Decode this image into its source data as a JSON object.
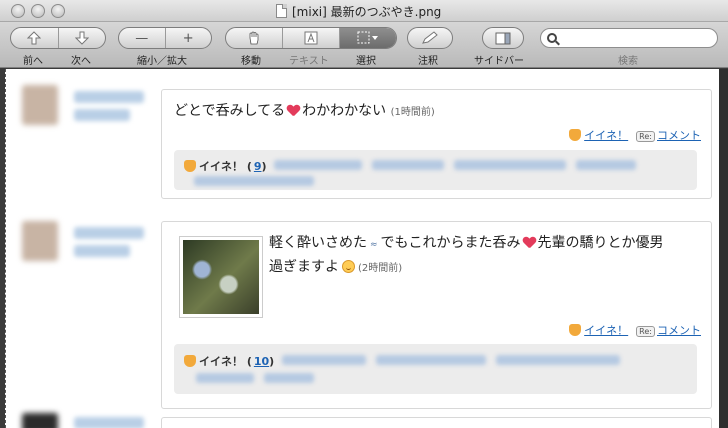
{
  "window": {
    "title": "[mixi] 最新のつぶやき.png"
  },
  "toolbar": {
    "back_label": "前へ",
    "forward_label": "次へ",
    "zoom_label": "縮小／拡大",
    "zoom_out_glyph": "—",
    "zoom_in_glyph": "+",
    "move_label": "移動",
    "text_label": "テキスト",
    "select_label": "選択",
    "annotate_label": "注釈",
    "sidebar_label": "サイドバー",
    "search_label": "検索",
    "search_placeholder": ""
  },
  "posts": [
    {
      "text_before": "どとで呑みしてる",
      "text_after": "わかわかない",
      "time": "(1時間前)",
      "iine_label": "イイネ！",
      "comment_label": "コメント",
      "re_badge": "Re:",
      "iine_count_prefix": "イイネ！ (",
      "iine_count": "9",
      "iine_count_suffix": ")"
    },
    {
      "text_line1_a": "軽く酔いさめた",
      "text_line1_b": "でもこれからまた呑み",
      "text_line1_c": "先輩の驕りとか優男",
      "text_line2": "過ぎますよ",
      "time": "(2時間前)",
      "iine_label": "イイネ！",
      "comment_label": "コメント",
      "re_badge": "Re:",
      "iine_count_prefix": "イイネ！ (",
      "iine_count": "10",
      "iine_count_suffix": ")"
    }
  ]
}
